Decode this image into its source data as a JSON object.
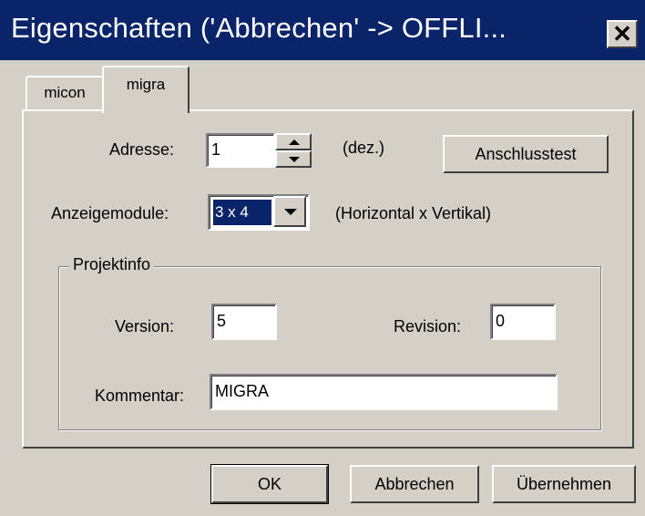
{
  "window": {
    "title": "Eigenschaften ('Abbrechen' -> OFFLI...",
    "close_glyph": "✕"
  },
  "tabs": [
    {
      "label": "micon",
      "active": false
    },
    {
      "label": "migra",
      "active": true
    }
  ],
  "form": {
    "adresse_label": "Adresse:",
    "adresse_value": "1",
    "adresse_unit": "(dez.)",
    "anschlusstest_label": "Anschlusstest",
    "anzeigemodule_label": "Anzeigemodule:",
    "anzeigemodule_value": "3 x 4",
    "anzeigemodule_hint": "(Horizontal x Vertikal)"
  },
  "projektinfo": {
    "title": "Projektinfo",
    "version_label": "Version:",
    "version_value": "5",
    "revision_label": "Revision:",
    "revision_value": "0",
    "kommentar_label": "Kommentar:",
    "kommentar_value": "MIGRA"
  },
  "buttons": {
    "ok_label": "OK",
    "abbrechen_label": "Abbrechen",
    "uebernehmen_label": "Übernehmen"
  },
  "colors": {
    "titlebar": "#0a246a",
    "face": "#d4d0c8"
  }
}
